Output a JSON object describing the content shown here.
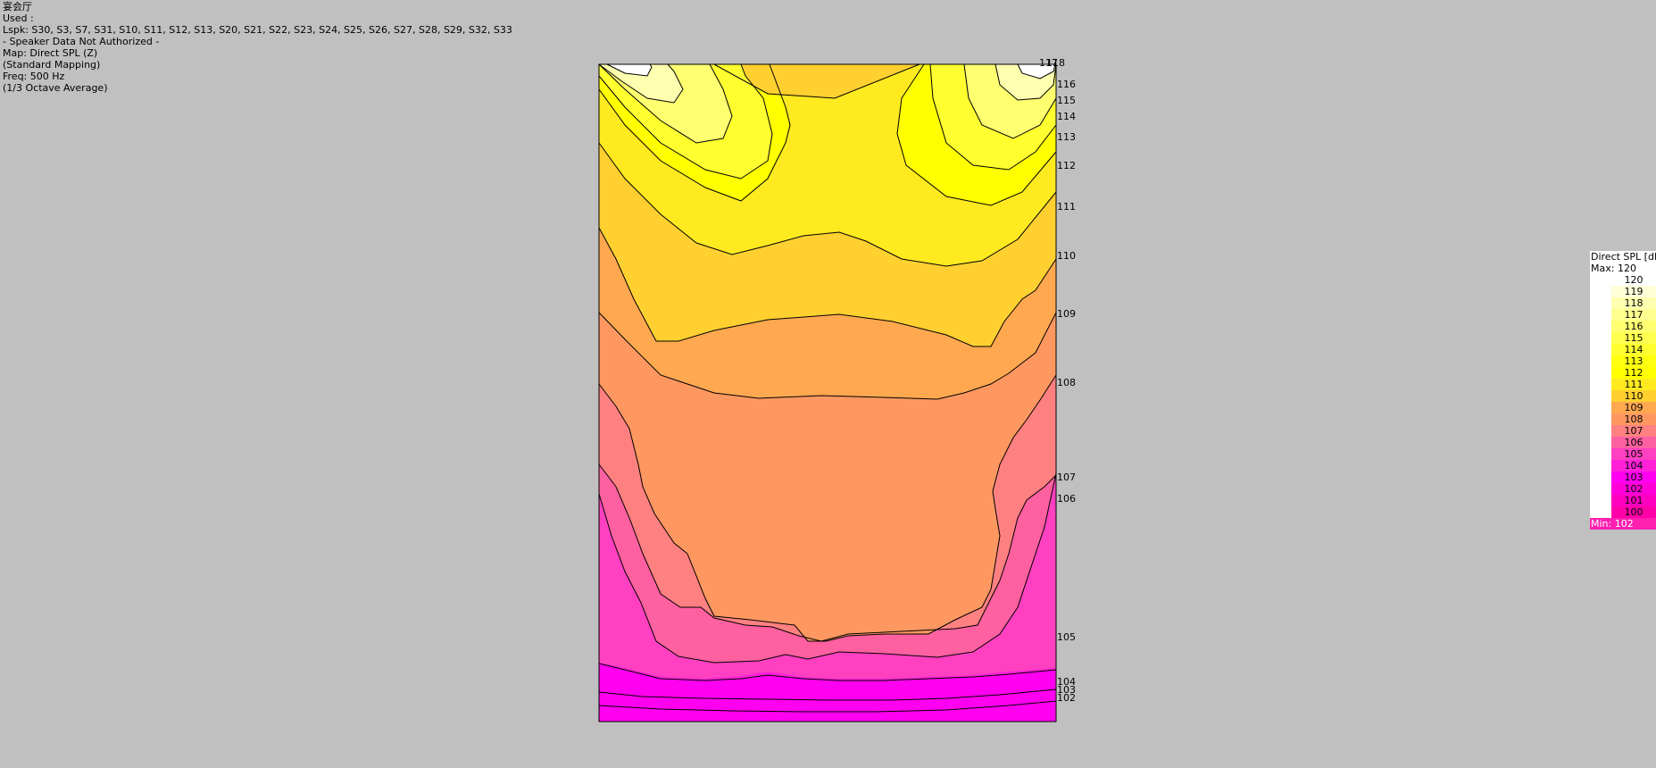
{
  "header": {
    "title": "宴会厅",
    "used": "Used :",
    "lspk": "Lspk: S30, S3, S7, S31, S10, S11, S12, S13, S20, S21, S22, S23, S24, S25, S26, S27, S28, S29, S32, S33",
    "auth": "- Speaker Data Not Authorized -",
    "map": "Map: Direct SPL (Z)",
    "mapping": "(Standard Mapping)",
    "freq": "Freq: 500 Hz",
    "average": "(1/3 Octave Average)"
  },
  "map": {
    "contour_labels": [
      "117",
      "118",
      "116",
      "115",
      "114",
      "113",
      "112",
      "111",
      "110",
      "109",
      "108",
      "107",
      "106",
      "105",
      "104",
      "103",
      "102"
    ]
  },
  "legend": {
    "title": "Direct SPL [dB]",
    "max": "Max:  120",
    "min": "Min:  102",
    "min_color": "#ff20b0",
    "levels": [
      {
        "label": "120",
        "color": "#ffffff"
      },
      {
        "label": "119",
        "color": "#ffffd8"
      },
      {
        "label": "118",
        "color": "#ffffb0"
      },
      {
        "label": "117",
        "color": "#ffff90"
      },
      {
        "label": "116",
        "color": "#ffff70"
      },
      {
        "label": "115",
        "color": "#ffff50"
      },
      {
        "label": "114",
        "color": "#ffff30"
      },
      {
        "label": "113",
        "color": "#ffff10"
      },
      {
        "label": "112",
        "color": "#ffff00"
      },
      {
        "label": "111",
        "color": "#ffea20"
      },
      {
        "label": "110",
        "color": "#ffd030"
      },
      {
        "label": "109",
        "color": "#ffa850"
      },
      {
        "label": "108",
        "color": "#ff9860"
      },
      {
        "label": "107",
        "color": "#ff8080"
      },
      {
        "label": "106",
        "color": "#ff60a0"
      },
      {
        "label": "105",
        "color": "#ff40c0"
      },
      {
        "label": "104",
        "color": "#ff20d8"
      },
      {
        "label": "103",
        "color": "#ff00f0"
      },
      {
        "label": "102",
        "color": "#ff00d8"
      },
      {
        "label": "101",
        "color": "#ff00c0"
      },
      {
        "label": "100",
        "color": "#ff00a8"
      }
    ]
  }
}
